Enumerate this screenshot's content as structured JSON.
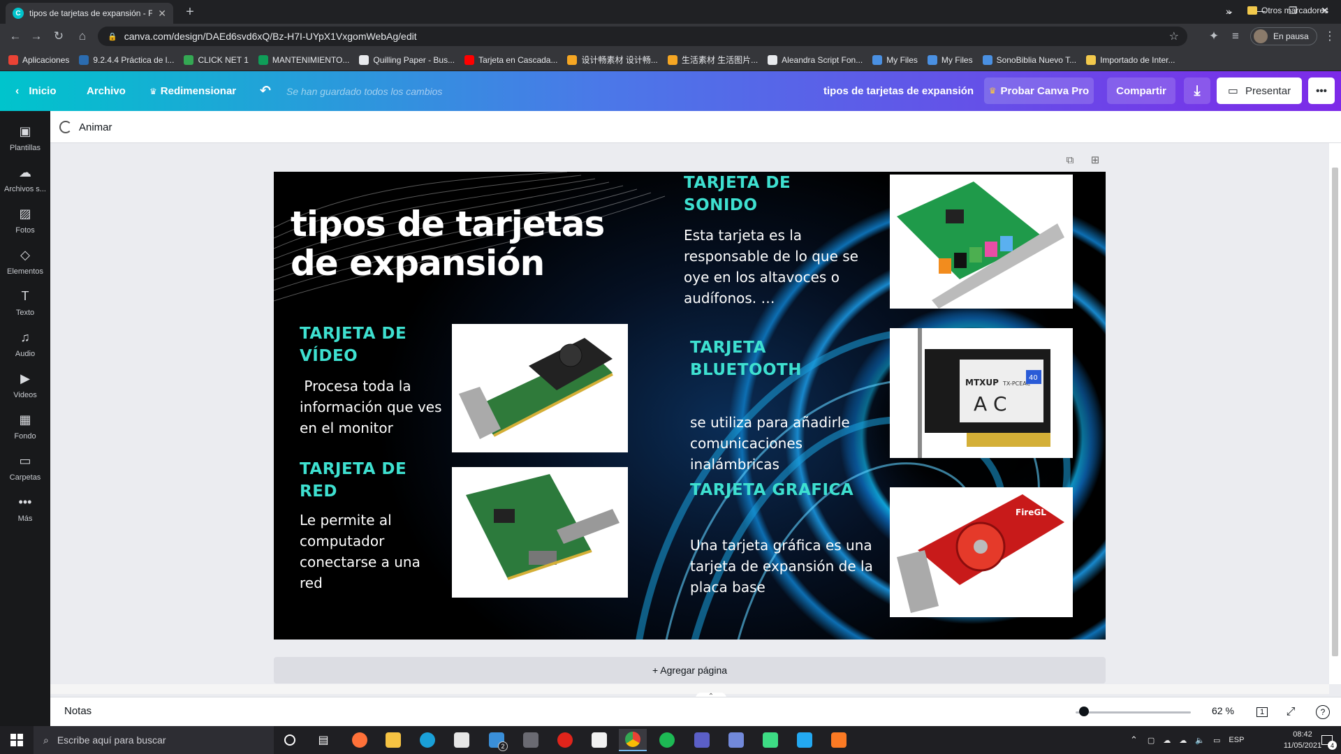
{
  "browser": {
    "tab_title": "tipos de tarjetas de expansión - F",
    "url": "canva.com/design/DAEd6svd6xQ/Bz-H7I-UYpX1VxgomWebAg/edit",
    "profile_label": "En pausa",
    "bookmarks": [
      {
        "label": "Aplicaciones",
        "color": "#ea4335"
      },
      {
        "label": "9.2.4.4 Práctica de l...",
        "color": "#2b6cb0"
      },
      {
        "label": "CLICK NET 1",
        "color": "#34a853"
      },
      {
        "label": "MANTENIMIENTO...",
        "color": "#0f9d58"
      },
      {
        "label": "Quilling Paper - Bus...",
        "color": "#e8eaed"
      },
      {
        "label": "Tarjeta en Cascada...",
        "color": "#ff0000"
      },
      {
        "label": "设计畅素材 设计畅...",
        "color": "#f5a623"
      },
      {
        "label": "生活素材 生活图片...",
        "color": "#f5a623"
      },
      {
        "label": "Aleandra Script Fon...",
        "color": "#e8eaed"
      },
      {
        "label": "My Files",
        "color": "#4a90e2"
      },
      {
        "label": "My Files",
        "color": "#4a90e2"
      },
      {
        "label": "SonoBiblia Nuevo T...",
        "color": "#4a90e2"
      },
      {
        "label": "Importado de Inter...",
        "color": "#f2c94c"
      }
    ],
    "bookmarks_more": "»",
    "bookmarks_other": "Otros marcadores"
  },
  "canva_header": {
    "home": "Inicio",
    "file": "Archivo",
    "resize": "Redimensionar",
    "saved_status": "Se han guardado todos los cambios",
    "design_title": "tipos de tarjetas de expansión",
    "try_pro": "Probar Canva Pro",
    "share": "Compartir",
    "present": "Presentar"
  },
  "sidebar": {
    "items": [
      {
        "label": "Plantillas",
        "icon": "templates-icon"
      },
      {
        "label": "Archivos s...",
        "icon": "upload-icon"
      },
      {
        "label": "Fotos",
        "icon": "photos-icon"
      },
      {
        "label": "Elementos",
        "icon": "elements-icon"
      },
      {
        "label": "Texto",
        "icon": "text-icon"
      },
      {
        "label": "Audio",
        "icon": "audio-icon"
      },
      {
        "label": "Videos",
        "icon": "video-icon"
      },
      {
        "label": "Fondo",
        "icon": "background-icon"
      },
      {
        "label": "Carpetas",
        "icon": "folder-icon"
      },
      {
        "label": "Más",
        "icon": "more-icon"
      }
    ]
  },
  "toolbar": {
    "animate": "Animar"
  },
  "design": {
    "title_line1": "tipos de tarjetas",
    "title_line2": "de expansión",
    "video": {
      "head1": "TARJETA DE",
      "head2": "VÍDEO",
      "body1": " Procesa toda la",
      "body2": "información que ves",
      "body3": "en el monitor"
    },
    "red": {
      "head1": "TARJETA DE",
      "head2": "RED",
      "body1": "Le permite al",
      "body2": "computador",
      "body3": "conectarse a una",
      "body4": "red"
    },
    "sonido": {
      "head1": "TARJETA DE",
      "head2": "SONIDO",
      "body1": "Esta tarjeta es la",
      "body2": "responsable de lo que se",
      "body3": "oye en los altavoces o",
      "body4": "audífonos. …"
    },
    "bluetooth": {
      "head1": "TARJETA",
      "head2": "BLUETOOTH",
      "body1": "se utiliza para añadirle",
      "body2": "comunicaciones",
      "body3": "inalámbricas"
    },
    "grafica": {
      "head1": "TARJETA GRAFICA",
      "body1": "Una tarjeta gráfica es una",
      "body2": "tarjeta de expansión de la",
      "body3": "placa base"
    },
    "bt_label1": "MTXUP",
    "bt_label2": "TX-PCEAC",
    "bt_label3": "A C",
    "bt_label4": "40",
    "fire_label": "FireGL"
  },
  "add_page": "+ Agregar página",
  "footer": {
    "notes": "Notas",
    "zoom": "62 %",
    "page_count": "1"
  },
  "taskbar": {
    "search_placeholder": "Escribe aquí para buscar",
    "lang": "ESP",
    "time": "08:42",
    "date": "11/05/2021",
    "mail_badge": "2",
    "notif_badge": "4"
  }
}
